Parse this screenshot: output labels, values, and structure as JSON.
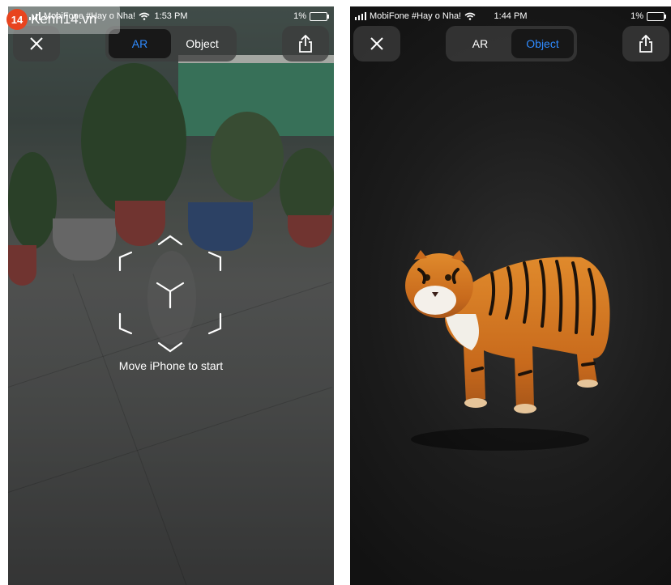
{
  "left_screen": {
    "status": {
      "carrier": "MobiFone #Hay o Nha!",
      "time": "1:53 PM",
      "battery": "1%"
    },
    "toolbar": {
      "ar_label": "AR",
      "object_label": "Object",
      "active_tab": "AR"
    },
    "hint": "Move iPhone to start"
  },
  "right_screen": {
    "status": {
      "carrier": "MobiFone #Hay o Nha!",
      "time": "1:44 PM",
      "battery": "1%"
    },
    "toolbar": {
      "ar_label": "AR",
      "object_label": "Object",
      "active_tab": "Object"
    }
  },
  "watermark": {
    "badge": "14",
    "text": "Kenh14.vn"
  },
  "icons": {
    "close": "close-icon",
    "share": "share-icon",
    "wifi": "wifi-icon",
    "battery": "battery-icon",
    "signal": "signal-icon"
  },
  "colors": {
    "accent": "#2f8bff"
  }
}
